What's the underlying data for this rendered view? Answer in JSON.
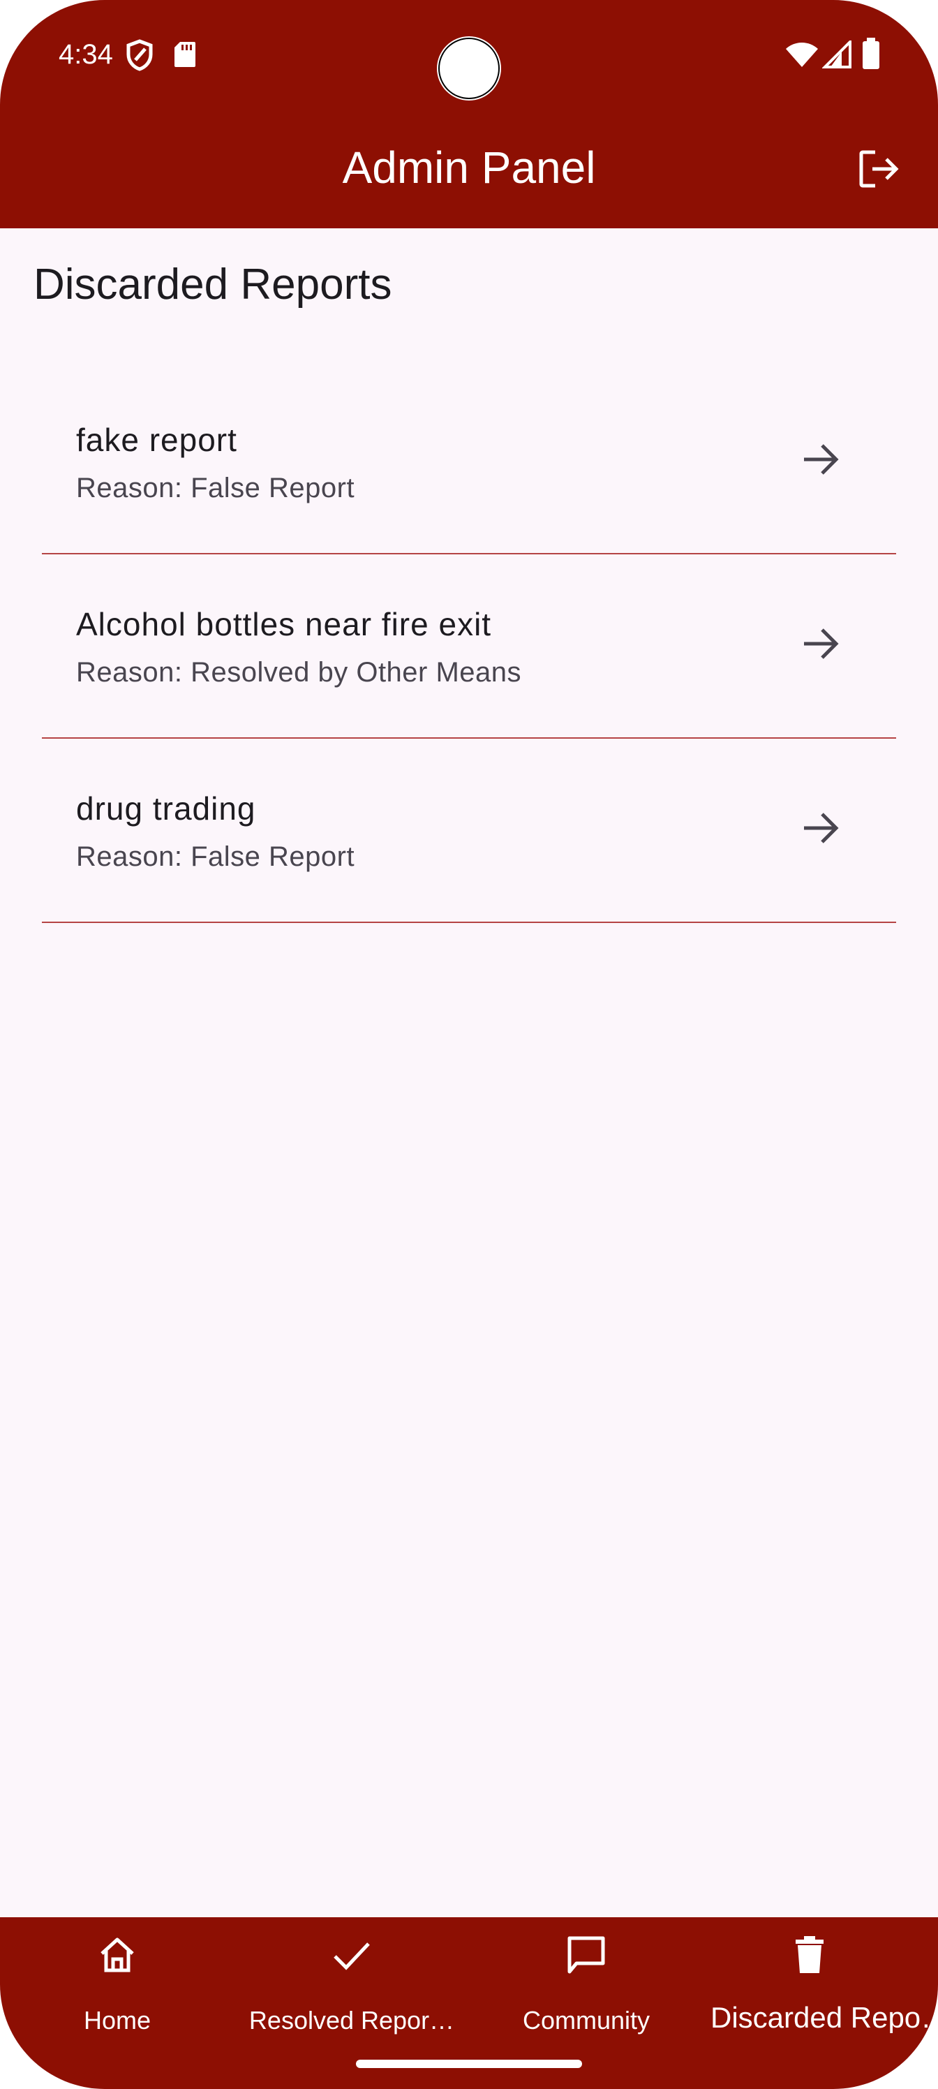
{
  "status_bar": {
    "time": "4:34"
  },
  "app_bar": {
    "title": "Admin Panel",
    "logout_icon": "logout-icon"
  },
  "page": {
    "heading": "Discarded Reports"
  },
  "reports": [
    {
      "title": "fake report",
      "reason": "Reason: False Report"
    },
    {
      "title": "Alcohol bottles near fire exit",
      "reason": "Reason: Resolved by Other Means"
    },
    {
      "title": "drug trading",
      "reason": "Reason: False Report"
    }
  ],
  "bottom_nav": {
    "items": [
      {
        "label": "Home",
        "icon": "home-icon"
      },
      {
        "label": "Resolved Repor…",
        "icon": "check-icon"
      },
      {
        "label": "Community",
        "icon": "chat-icon"
      },
      {
        "label": "Discarded Repo…",
        "icon": "trash-icon",
        "active": true
      }
    ]
  },
  "colors": {
    "brand": "#8d0f03",
    "background": "#fcf6fb",
    "divider": "#b54444"
  }
}
